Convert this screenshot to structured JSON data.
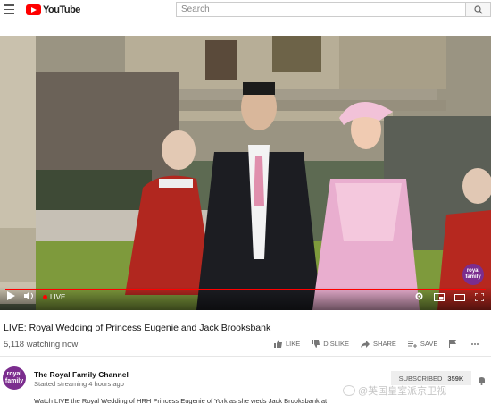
{
  "header": {
    "logo_text": "YouTube",
    "search_placeholder": "Search"
  },
  "player": {
    "live_label": "LIVE",
    "progress": 1.0,
    "watermark": "royal family",
    "accent_color": "#ff0000"
  },
  "video": {
    "title": "LIVE: Royal Wedding of Princess Eugenie and Jack Brooksbank",
    "watching": "5,118 watching now"
  },
  "actions": [
    {
      "icon": "thumbs-up-icon",
      "label": "LIKE"
    },
    {
      "icon": "thumbs-down-icon",
      "label": "DISLIKE"
    },
    {
      "icon": "share-icon",
      "label": "SHARE"
    },
    {
      "icon": "playlist-add-icon",
      "label": "SAVE"
    },
    {
      "icon": "flag-icon",
      "label": ""
    },
    {
      "icon": "more-icon",
      "label": ""
    }
  ],
  "channel": {
    "avatar_text": "royal family",
    "name": "The Royal Family Channel",
    "started": "Started streaming 4 hours ago",
    "subscribe_label": "SUBSCRIBED",
    "subscriber_count": "359K"
  },
  "description": "Watch LIVE the Royal Wedding of HRH Princess Eugenie of York as she weds Jack Brooksbank at",
  "watermark_text": "@英国皇室派京卫视"
}
